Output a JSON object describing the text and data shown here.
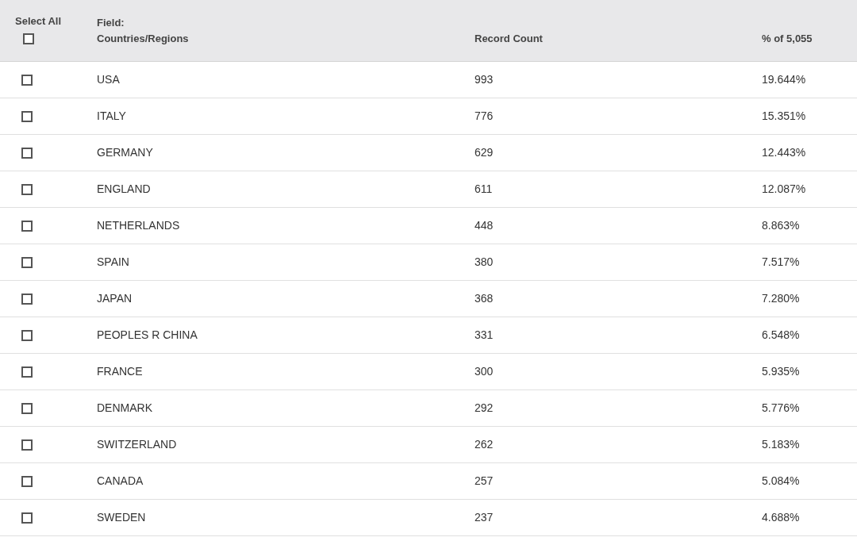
{
  "table": {
    "select_all": {
      "label": "Select All",
      "checked": false
    },
    "columns": [
      "Field:\nCountries/Regions",
      "Record Count",
      "% of 5,055"
    ],
    "rows": [
      {
        "name": "USA",
        "count": "993",
        "percent": "19.644%",
        "checked": false
      },
      {
        "name": "ITALY",
        "count": "776",
        "percent": "15.351%",
        "checked": false
      },
      {
        "name": "GERMANY",
        "count": "629",
        "percent": "12.443%",
        "checked": false
      },
      {
        "name": "ENGLAND",
        "count": "611",
        "percent": "12.087%",
        "checked": false
      },
      {
        "name": "NETHERLANDS",
        "count": "448",
        "percent": "8.863%",
        "checked": false
      },
      {
        "name": "SPAIN",
        "count": "380",
        "percent": "7.517%",
        "checked": false
      },
      {
        "name": "JAPAN",
        "count": "368",
        "percent": "7.280%",
        "checked": false
      },
      {
        "name": "PEOPLES R CHINA",
        "count": "331",
        "percent": "6.548%",
        "checked": false
      },
      {
        "name": "FRANCE",
        "count": "300",
        "percent": "5.935%",
        "checked": false
      },
      {
        "name": "DENMARK",
        "count": "292",
        "percent": "5.776%",
        "checked": false
      },
      {
        "name": "SWITZERLAND",
        "count": "262",
        "percent": "5.183%",
        "checked": false
      },
      {
        "name": "CANADA",
        "count": "257",
        "percent": "5.084%",
        "checked": false
      },
      {
        "name": "SWEDEN",
        "count": "237",
        "percent": "4.688%",
        "checked": false
      }
    ]
  }
}
